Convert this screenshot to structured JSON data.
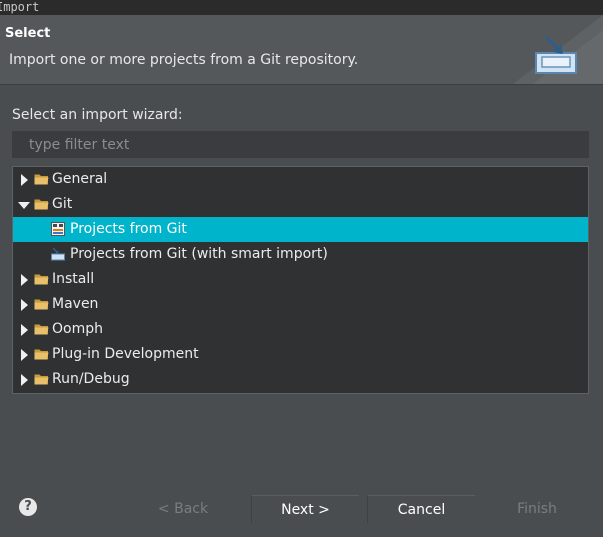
{
  "window": {
    "title": "Import"
  },
  "header": {
    "title": "Select",
    "description": "Import one or more projects from a Git repository."
  },
  "wizard_label": "Select an import wizard:",
  "filter": {
    "placeholder": "type filter text",
    "value": ""
  },
  "tree": {
    "items": [
      {
        "label": "General",
        "expanded": false,
        "level": 0,
        "icon": "folder-icon"
      },
      {
        "label": "Git",
        "expanded": true,
        "level": 0,
        "icon": "folder-icon"
      },
      {
        "label": "Projects from Git",
        "level": 1,
        "selected": true,
        "icon": "git-repo-icon"
      },
      {
        "label": "Projects from Git (with smart import)",
        "level": 1,
        "icon": "git-import-icon"
      },
      {
        "label": "Install",
        "expanded": false,
        "level": 0,
        "icon": "folder-icon"
      },
      {
        "label": "Maven",
        "expanded": false,
        "level": 0,
        "icon": "folder-icon"
      },
      {
        "label": "Oomph",
        "expanded": false,
        "level": 0,
        "icon": "folder-icon"
      },
      {
        "label": "Plug-in Development",
        "expanded": false,
        "level": 0,
        "icon": "folder-icon"
      },
      {
        "label": "Run/Debug",
        "expanded": false,
        "level": 0,
        "icon": "folder-icon"
      }
    ]
  },
  "buttons": {
    "help": "?",
    "back": "< Back",
    "next": "Next >",
    "cancel": "Cancel",
    "finish": "Finish"
  },
  "colors": {
    "selection": "#00b4cc",
    "background": "#4a4d50",
    "tree_background": "#2f3133"
  }
}
